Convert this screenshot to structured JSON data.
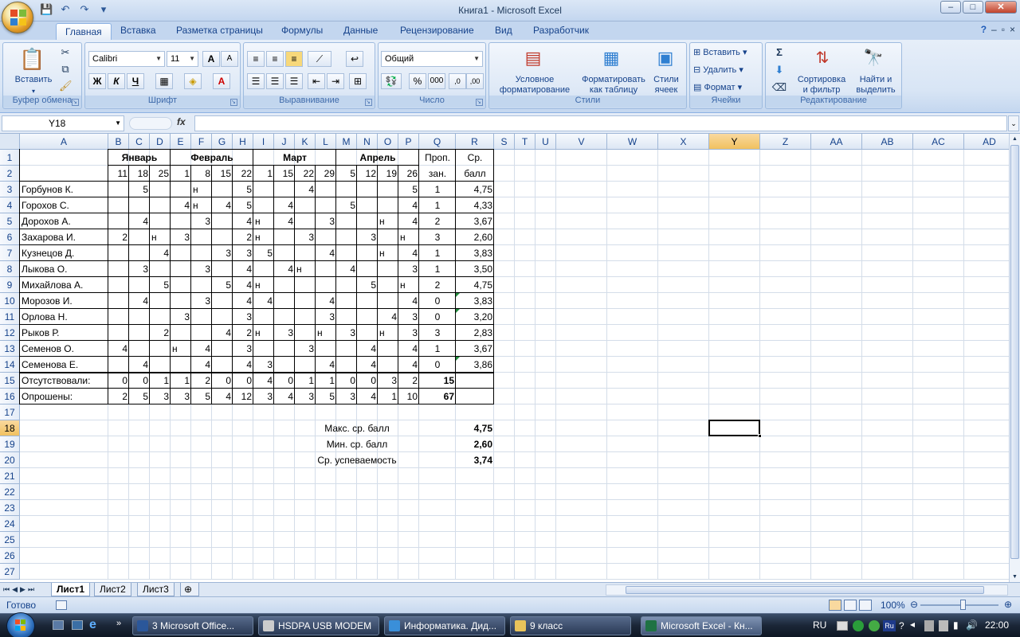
{
  "window": {
    "title": "Книга1 - Microsoft Excel",
    "minimize": "–",
    "maximize": "□",
    "close": "✕"
  },
  "qat": {
    "save": "💾",
    "undo": "↶",
    "redo": "↷",
    "more": "▾"
  },
  "tabs": [
    "Главная",
    "Вставка",
    "Разметка страницы",
    "Формулы",
    "Данные",
    "Рецензирование",
    "Вид",
    "Разработчик"
  ],
  "ribbon": {
    "clipboard": {
      "label": "Буфер обмена",
      "paste": "Вставить"
    },
    "font": {
      "label": "Шрифт",
      "name": "Calibri",
      "size": "11",
      "bold": "Ж",
      "italic": "К",
      "underline": "Ч",
      "grow": "A",
      "shrink": "A",
      "color_letter": "A"
    },
    "alignment": {
      "label": "Выравнивание"
    },
    "number": {
      "label": "Число",
      "format": "Общий",
      "percent": "%",
      "thousands": "000",
      "inc": ",0",
      "dec": ",00"
    },
    "styles": {
      "label": "Стили",
      "conditional": "Условное\nформатирование",
      "astable": "Форматировать\nкак таблицу",
      "cellstyles": "Стили\nячеек"
    },
    "cells": {
      "label": "Ячейки",
      "insert": "Вставить",
      "delete": "Удалить",
      "format": "Формат"
    },
    "editing": {
      "label": "Редактирование",
      "sort": "Сортировка\nи фильтр",
      "find": "Найти и\nвыделить",
      "sum": "Σ"
    }
  },
  "formula_bar": {
    "namebox": "Y18",
    "fx": "fx",
    "value": ""
  },
  "columns": [
    "A",
    "B",
    "C",
    "D",
    "E",
    "F",
    "G",
    "H",
    "I",
    "J",
    "K",
    "L",
    "M",
    "N",
    "O",
    "P",
    "Q",
    "R",
    "S",
    "T",
    "U",
    "V",
    "W",
    "X",
    "Y",
    "Z",
    "AA",
    "AB",
    "AC",
    "AD"
  ],
  "rows": [
    "1",
    "2",
    "3",
    "4",
    "5",
    "6",
    "7",
    "8",
    "9",
    "10",
    "11",
    "12",
    "13",
    "14",
    "15",
    "16",
    "17",
    "18",
    "19",
    "20",
    "21",
    "22",
    "23",
    "24",
    "25",
    "26",
    "27"
  ],
  "sheet": {
    "months": [
      "Январь",
      "Февраль",
      "Март",
      "Апрель"
    ],
    "header_q": [
      "Проп.",
      "зан."
    ],
    "header_r": [
      "Ср.",
      "балл"
    ],
    "days": [
      "11",
      "18",
      "25",
      "1",
      "8",
      "15",
      "22",
      "1",
      "15",
      "22",
      "29",
      "5",
      "12",
      "19",
      "26"
    ],
    "students": [
      {
        "name": "Горбунов К.",
        "marks": [
          "",
          "5",
          "",
          "",
          "н",
          "",
          "5",
          "",
          "",
          "4",
          "",
          "",
          "",
          "",
          "5"
        ],
        "q": "1",
        "r": "4,75"
      },
      {
        "name": "Горохов С.",
        "marks": [
          "",
          "",
          "",
          "4",
          "н",
          "4",
          "5",
          "",
          "4",
          "",
          "",
          "5",
          "",
          "",
          "4"
        ],
        "q": "1",
        "r": "4,33"
      },
      {
        "name": "Дорохов А.",
        "marks": [
          "",
          "4",
          "",
          "",
          "3",
          "",
          "4",
          "н",
          "4",
          "",
          "3",
          "",
          "",
          "н",
          "4"
        ],
        "q": "2",
        "r": "3,67"
      },
      {
        "name": "Захарова И.",
        "marks": [
          "2",
          "",
          "н",
          "3",
          "",
          "",
          "2",
          "н",
          "",
          "3",
          "",
          "",
          "3",
          "",
          "н"
        ],
        "q": "3",
        "r": "2,60"
      },
      {
        "name": "Кузнецов Д.",
        "marks": [
          "",
          "",
          "4",
          "",
          "",
          "3",
          "3",
          "5",
          "",
          "",
          "4",
          "",
          "",
          "н",
          "4"
        ],
        "q": "1",
        "r": "3,83"
      },
      {
        "name": "Лыкова О.",
        "marks": [
          "",
          "3",
          "",
          "",
          "3",
          "",
          "4",
          "",
          "4",
          "н",
          "",
          "4",
          "",
          "",
          "3"
        ],
        "q": "1",
        "r": "3,50"
      },
      {
        "name": "Михайлова А.",
        "marks": [
          "",
          "",
          "5",
          "",
          "",
          "5",
          "4",
          "н",
          "",
          "",
          "",
          "",
          "5",
          "",
          "н"
        ],
        "q": "2",
        "r": "4,75"
      },
      {
        "name": "Морозов И.",
        "marks": [
          "",
          "4",
          "",
          "",
          "3",
          "",
          "4",
          "4",
          "",
          "",
          "4",
          "",
          "",
          "",
          "4"
        ],
        "q": "0",
        "r": "3,83"
      },
      {
        "name": "Орлова Н.",
        "marks": [
          "",
          "",
          "",
          "3",
          "",
          "",
          "3",
          "",
          "",
          "",
          "3",
          "",
          "",
          "4",
          "3"
        ],
        "q": "0",
        "r": "3,20"
      },
      {
        "name": "Рыков Р.",
        "marks": [
          "",
          "",
          "2",
          "",
          "",
          "4",
          "2",
          "н",
          "3",
          "",
          "н",
          "3",
          "",
          "н",
          "3"
        ],
        "q": "3",
        "r": "2,83"
      },
      {
        "name": "Семенов О.",
        "marks": [
          "4",
          "",
          "",
          "н",
          "4",
          "",
          "3",
          "",
          "",
          "3",
          "",
          "",
          "4",
          "",
          "4"
        ],
        "q": "1",
        "r": "3,67"
      },
      {
        "name": "Семенова Е.",
        "marks": [
          "",
          "4",
          "",
          "",
          "4",
          "",
          "4",
          "3",
          "",
          "",
          "4",
          "",
          "4",
          "",
          "4"
        ],
        "q": "0",
        "r": "3,86"
      }
    ],
    "absent": {
      "label": "Отсутствовали:",
      "values": [
        "0",
        "0",
        "1",
        "1",
        "2",
        "0",
        "0",
        "4",
        "0",
        "1",
        "1",
        "0",
        "0",
        "3",
        "2"
      ],
      "total": "15"
    },
    "asked": {
      "label": "Опрошены:",
      "values": [
        "2",
        "5",
        "3",
        "3",
        "5",
        "4",
        "12",
        "3",
        "4",
        "3",
        "5",
        "3",
        "4",
        "1",
        "10"
      ],
      "total": "67"
    },
    "summary": [
      {
        "label": "Макс. ср. балл",
        "value": "4,75"
      },
      {
        "label": "Мин. ср. балл",
        "value": "2,60"
      },
      {
        "label": "Ср. успеваемость",
        "value": "3,74"
      }
    ]
  },
  "sheet_tabs": [
    "Лист1",
    "Лист2",
    "Лист3"
  ],
  "status": {
    "ready": "Готово",
    "zoom": "100%"
  },
  "taskbar": {
    "items": [
      "3 Microsoft Office...",
      "HSDPA USB MODEM",
      "Информатика. Дид...",
      "9 класс",
      "Microsoft Excel - Кн..."
    ],
    "lang": "RU",
    "clock": "22:00"
  },
  "colors": {
    "accent": "#15428b",
    "ribbon": "#d8e5f5",
    "selected_header": "#f1c15f"
  }
}
